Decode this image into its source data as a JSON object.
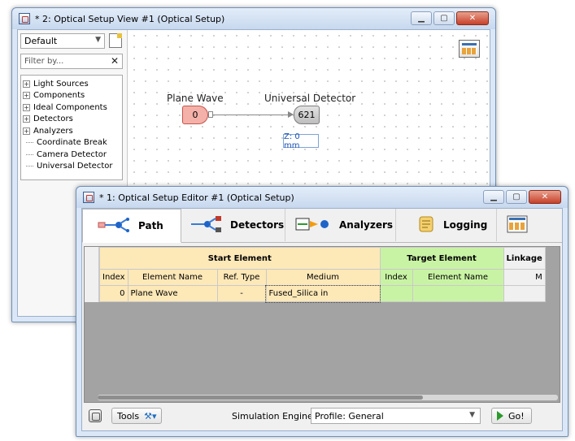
{
  "view_window": {
    "title": "* 2: Optical Setup View #1 (Optical Setup)",
    "preset_combo": "Default",
    "filter_placeholder": "Filter by...",
    "tree": [
      {
        "label": "Light Sources",
        "expandable": true
      },
      {
        "label": "Components",
        "expandable": true
      },
      {
        "label": "Ideal Components",
        "expandable": true
      },
      {
        "label": "Detectors",
        "expandable": true
      },
      {
        "label": "Analyzers",
        "expandable": true
      },
      {
        "label": "Coordinate Break",
        "expandable": false
      },
      {
        "label": "Camera Detector",
        "expandable": false
      },
      {
        "label": "Universal Detector",
        "expandable": false
      }
    ],
    "diagram": {
      "source_label": "Plane Wave",
      "source_index": "0",
      "detector_label": "Universal Detector",
      "detector_index": "621",
      "z_position": "Z: 0 mm"
    }
  },
  "editor_window": {
    "title": "* 1: Optical Setup Editor #1 (Optical Setup)",
    "tabs": [
      {
        "label": "Path",
        "active": true,
        "icon": "path-icon"
      },
      {
        "label": "Detectors",
        "active": false,
        "icon": "detectors-icon"
      },
      {
        "label": "Analyzers",
        "active": false,
        "icon": "analyzers-icon"
      },
      {
        "label": "Logging",
        "active": false,
        "icon": "logging-icon"
      }
    ],
    "table": {
      "group_start": "Start Element",
      "group_target": "Target Element",
      "group_linkage": "Linkage",
      "columns": [
        "Index",
        "Element Name",
        "Ref. Type",
        "Medium",
        "Index",
        "Element Name",
        "M"
      ],
      "rows": [
        [
          "0",
          "Plane Wave",
          "-",
          "Fused_Silica in",
          "",
          "",
          ""
        ]
      ]
    },
    "bottom": {
      "tools_label": "Tools",
      "sim_engine_label": "Simulation Engine",
      "sim_engine_value": "Profile: General",
      "go_label": "Go!"
    }
  },
  "colors": {
    "start_header": "#fde8b8",
    "target_header": "#c9f3a4",
    "source_node": "#f4b1a9",
    "detector_node": "#bdbdbd"
  }
}
